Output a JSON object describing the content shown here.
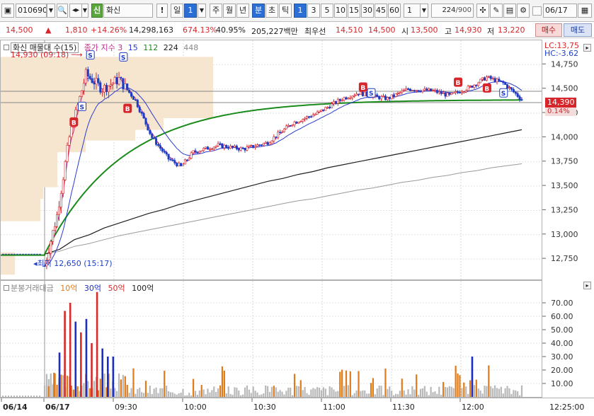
{
  "toolbar": {
    "code": "010690",
    "name_badge": "신",
    "name": "화신",
    "excl": "!",
    "period_label": "일",
    "period_count": "1",
    "btn_week": "주",
    "btn_month": "월",
    "btn_year": "년",
    "btn_minute": "분",
    "btn_second": "초",
    "btn_tick": "틱",
    "minute_options": [
      "1",
      "3",
      "5",
      "10",
      "15",
      "30",
      "45",
      "60"
    ],
    "minute_selected": "1",
    "interval_value": "1",
    "count_display": "224",
    "count_total": "/900",
    "date_value": "06/17"
  },
  "quote": {
    "price": "14,500",
    "arrow": "▲",
    "change": "1,810",
    "change_pct": "+14.26%",
    "volume": "14,298,163",
    "vol_ratio": "674.13%",
    "turnover": "40.95%",
    "amount": "205,227백만",
    "best_label": "최우선",
    "best_ask": "14,510",
    "best_bid": "14,500",
    "open_label": "시",
    "open": "13,500",
    "high_label": "고",
    "high": "14,930",
    "low_label": "저",
    "low": "13,220",
    "buy_button": "매수",
    "sell_button": "매도"
  },
  "price_panel": {
    "legend_name": "화신 매물대 수(15)",
    "legend_ma_label": "종가 지수 3",
    "legend_ma": [
      "15",
      "112",
      "224",
      "448"
    ],
    "high_annotation": "14,930 (09:18)",
    "low_annotation": "최저 12,650 (15:17)",
    "lc": "LC:13,75",
    "hc": "HC:-3.62",
    "current_price": "14,390",
    "current_pct": "0.14%"
  },
  "vol_panel": {
    "legend_name": "분봉거래대금",
    "legend_items": [
      {
        "label": "10억",
        "color": "#e07b1a"
      },
      {
        "label": "30억",
        "color": "#1c2fc4"
      },
      {
        "label": "50억",
        "color": "#d62b2b"
      },
      {
        "label": "100억",
        "color": "#222222"
      }
    ]
  },
  "time_axis": {
    "labels": [
      "06/14",
      "06/17",
      "09:30",
      "10:00",
      "10:30",
      "11:00",
      "11:30",
      "12:00"
    ],
    "right_label": "12:25:00"
  },
  "chart_data": {
    "type": "candlestick",
    "title": "",
    "y_axis_price": {
      "ticks": [
        12750,
        13000,
        13250,
        13500,
        13750,
        14000,
        14250,
        14500,
        14750
      ],
      "tick_labels": [
        "12,750",
        "13,000",
        "13,250",
        "13,500",
        "13,750",
        "14,000",
        "14,250",
        "14,500",
        "14,750"
      ],
      "range": [
        12540,
        15000
      ]
    },
    "y_axis_volume": {
      "ticks": [
        10,
        20,
        30,
        40,
        50,
        60,
        70
      ],
      "tick_labels": [
        "10.00",
        "20.00",
        "30.00",
        "40.00",
        "50.00",
        "60.00",
        "70.00"
      ],
      "range": [
        0,
        80
      ]
    },
    "series": [
      {
        "name": "224",
        "values": [
          12790,
          12790,
          12790,
          12790,
          12790,
          12790,
          12790,
          12790,
          12800,
          12850,
          12950,
          13000,
          13070,
          13120,
          13170,
          13220,
          13260,
          13310,
          13350,
          13390,
          13430,
          13470,
          13510,
          13550,
          13580,
          13620,
          13650,
          13690,
          13720,
          13750,
          13780,
          13810,
          13840,
          13870,
          13900,
          13930,
          13960,
          13990,
          14020,
          14050,
          14080
        ]
      },
      {
        "name": "448",
        "values": [
          12790,
          12790,
          12790,
          12790,
          12790,
          12790,
          12790,
          12790,
          12800,
          12830,
          12880,
          12910,
          12950,
          12990,
          13020,
          13050,
          13080,
          13110,
          13140,
          13170,
          13200,
          13230,
          13260,
          13290,
          13320,
          13350,
          13370,
          13400,
          13430,
          13460,
          13480,
          13510,
          13540,
          13560,
          13590,
          13610,
          13640,
          13660,
          13690,
          13710,
          13730
        ]
      }
    ],
    "volume_colored_bars": [
      {
        "time_index": 0,
        "value": 8,
        "color": "#e07b1a"
      },
      {
        "time_index": 1,
        "value": 18,
        "color": "#e07b1a"
      },
      {
        "time_index": 2,
        "value": 33,
        "color": "#1c2fc4"
      },
      {
        "time_index": 3,
        "value": 64,
        "color": "#d62b2b"
      },
      {
        "time_index": 4,
        "value": 70,
        "color": "#d62b2b"
      },
      {
        "time_index": 5,
        "value": 56,
        "color": "#1c2fc4"
      },
      {
        "time_index": 6,
        "value": 48,
        "color": "#d62b2b"
      },
      {
        "time_index": 7,
        "value": 58,
        "color": "#1c2fc4"
      },
      {
        "time_index": 8,
        "value": 40,
        "color": "#d62b2b"
      },
      {
        "time_index": 9,
        "value": 78,
        "color": "#d62b2b"
      },
      {
        "time_index": 10,
        "value": 36,
        "color": "#1c2fc4"
      },
      {
        "time_index": 11,
        "value": 30,
        "color": "#1c2fc4"
      },
      {
        "time_index": 12,
        "value": 30,
        "color": "#1c2fc4"
      }
    ]
  }
}
